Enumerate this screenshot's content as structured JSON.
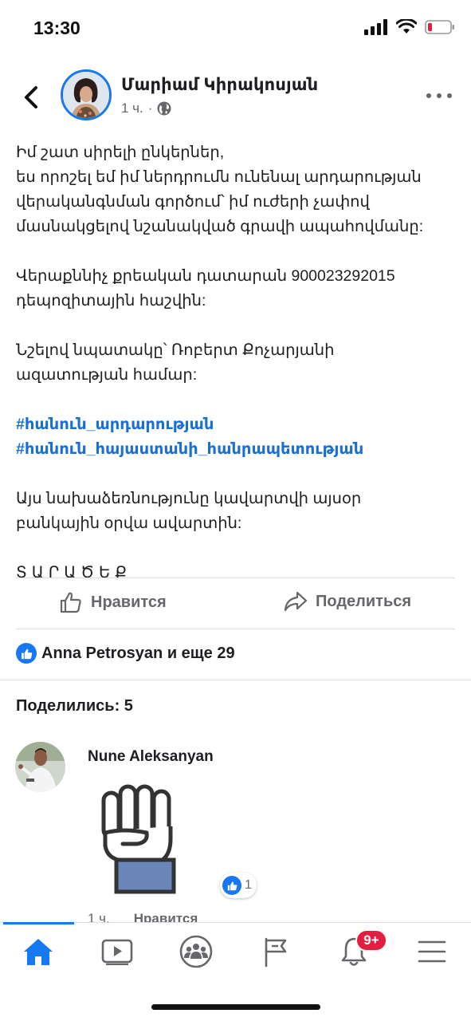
{
  "status_bar": {
    "time": "13:30"
  },
  "post": {
    "author": "Մարիամ Կիրակոսյան",
    "time": "1 ч.",
    "separator": "·",
    "paragraphs": [
      [
        "Իմ շատ սիրելի ընկերներ,",
        "ես որոշել եմ իմ ներդրումն ունենալ արդարության",
        "վերականգնման գործում՝ իմ ուժերի չափով",
        "մասնակցելով նշանակված գրավի ապահովմանը:"
      ],
      [
        "Վերաքննիչ քրեական դատարան 900023292015",
        "դեպոզիտային հաշվին:"
      ],
      [
        "Նշելով նպատակը՝ Ռոբերտ Քոչարյանի",
        "ազատության համար:"
      ]
    ],
    "hashtags": [
      "#հանուն_արդարության",
      "#հանուն_հայաստանի_հանրապետության"
    ],
    "paragraph_after": [
      "Այս նախաձեռնությունը կավարտվի այսօր",
      "բանկային օրվա ավարտին:"
    ],
    "closing": "ՏԱՐԱԾԵՔ"
  },
  "actions": {
    "like_label": "Нравится",
    "share_label": "Поделиться"
  },
  "reactions": {
    "summary": "Anna Petrosyan и еще 29"
  },
  "shares": {
    "title": "Поделились: 5",
    "entry": {
      "name": "Nune Aleksanyan",
      "reaction_count": "1",
      "time": "1 ч.",
      "like_label": "Нравится"
    }
  },
  "tabs": [
    {
      "name": "home",
      "icon": "home-icon",
      "active": true
    },
    {
      "name": "watch",
      "icon": "video-icon"
    },
    {
      "name": "groups",
      "icon": "groups-icon"
    },
    {
      "name": "pages",
      "icon": "flag-icon"
    },
    {
      "name": "notifications",
      "icon": "bell-icon",
      "badge": "9+"
    },
    {
      "name": "menu",
      "icon": "hamburger-menu-icon"
    }
  ],
  "colors": {
    "accent": "#1877f2",
    "hashtag": "#1a6fd6",
    "badge": "#e41e3f",
    "muted": "#65676b"
  }
}
